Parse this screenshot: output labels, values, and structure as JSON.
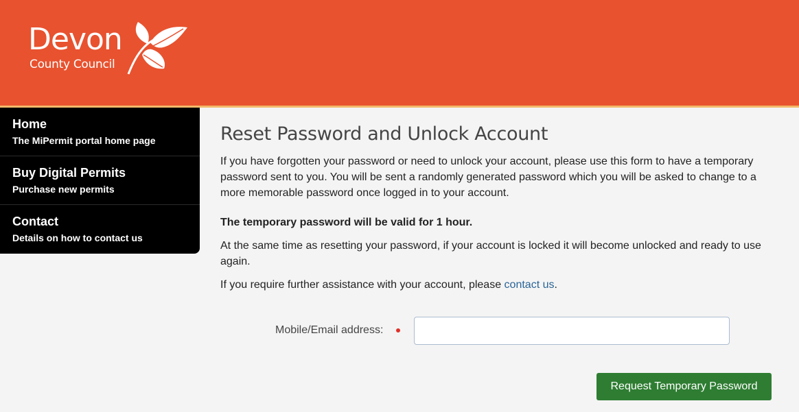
{
  "header": {
    "logo_line1": "Devon",
    "logo_line2": "County Council",
    "brand_color": "#e8522f",
    "accent_rule_color": "#f2b96a",
    "logo_icon": "leaf-icon"
  },
  "sidebar": {
    "items": [
      {
        "title": "Home",
        "subtitle": "The MiPermit portal home page"
      },
      {
        "title": "Buy Digital Permits",
        "subtitle": "Purchase new permits"
      },
      {
        "title": "Contact",
        "subtitle": "Details on how to contact us"
      }
    ]
  },
  "main": {
    "title": "Reset Password and Unlock Account",
    "intro": "If you have forgotten your password or need to unlock your account, please use this form to have a temporary password sent to you. You will be sent a randomly generated password which you will be asked to change to a more memorable password once logged in to your account.",
    "validity_note": "The temporary password will be valid for 1 hour.",
    "unlock_note": "At the same time as resetting your password, if your account is locked it will become unlocked and ready to use again.",
    "assist_prefix": "If you require further assistance with your account, please ",
    "assist_link": "contact us",
    "assist_suffix": "."
  },
  "form": {
    "field_label": "Mobile/Email address:",
    "field_value": "",
    "required_color": "#e0302a",
    "submit_label": "Request Temporary Password",
    "submit_color": "#2e7d32"
  }
}
